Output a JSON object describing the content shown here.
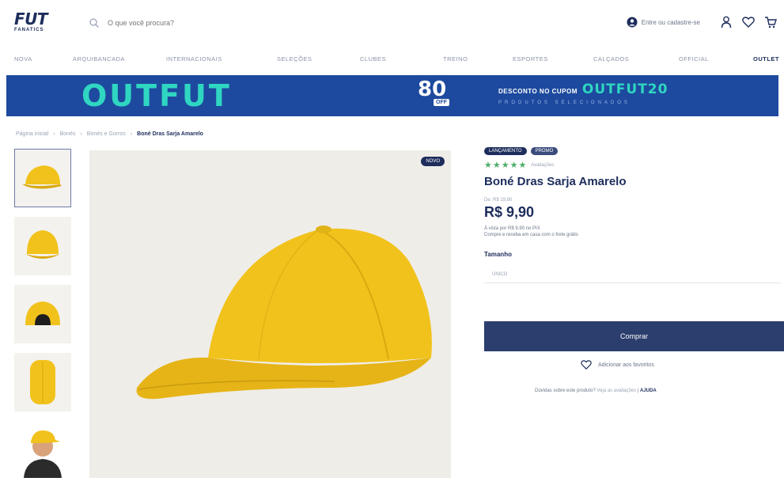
{
  "header": {
    "logo_main": "FUT",
    "logo_sub": "FANATICS",
    "search_placeholder": "O que você procura?",
    "account_link": "Entre ou cadastre-se",
    "icons": [
      "user-icon",
      "heart-icon",
      "cart-icon"
    ]
  },
  "nav": {
    "items": [
      {
        "label": "NOVA"
      },
      {
        "label": "ARQUIBANCADA"
      },
      {
        "label": "INTERNACIONAIS"
      },
      {
        "label": "SELEÇÕES"
      },
      {
        "label": "CLUBES"
      },
      {
        "label": "TREINO"
      },
      {
        "label": "ESPORTES"
      },
      {
        "label": "CALÇADOS"
      },
      {
        "label": "OFFICIAL"
      },
      {
        "label": "OUTLET"
      }
    ]
  },
  "banner": {
    "title": "OUTFUT",
    "mid_text": "",
    "percent": "80",
    "percent_suffix": "OFF",
    "coupon_prefix": "DESCONTO NO CUPOM",
    "coupon_code": "OUTFUT20",
    "coupon_sub": "PRODUTOS SELECIONADOS"
  },
  "breadcrumb": {
    "items": [
      "Página inicial",
      "Bonés",
      "Bonés e Gorros"
    ],
    "current": "Boné Dras Sarja Amarelo"
  },
  "gallery": {
    "badge": "NOVO",
    "thumb_count": 5
  },
  "product": {
    "tags": [
      "LANÇAMENTO",
      "PROMO"
    ],
    "rating_stars": 5,
    "rating_text": "Avaliações",
    "title": "Boné Dras Sarja Amarelo",
    "old_price": "De: R$ 19,90",
    "price": "R$ 9,90",
    "pay_note_1": "À vista por R$ 9,90 no PIX",
    "pay_note_2": "Compre e receba em casa com o frete grátis",
    "size_label": "Tamanho",
    "size_value": "ÚNICO",
    "buy_label": "Comprar",
    "wishlist_label": "Adicionar aos favoritos",
    "help_prefix": "Dúvidas sobre este produto?",
    "help_link": "Veja as avaliações",
    "help_strong": "AJUDA"
  },
  "colors": {
    "navy": "#1d2d5c",
    "banner_blue": "#1d4a9e",
    "teal": "#2fd6c1",
    "cap_yellow": "#f1c21b",
    "star_green": "#4fae6a"
  }
}
